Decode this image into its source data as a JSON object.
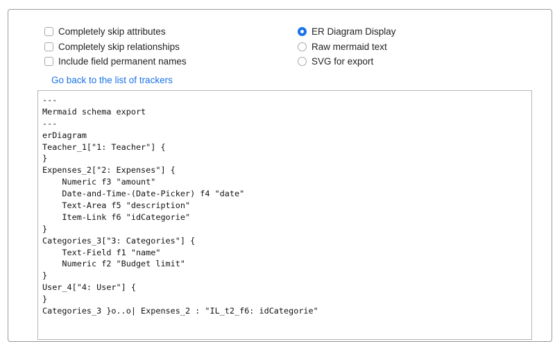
{
  "checkboxes": [
    {
      "label": "Completely skip attributes",
      "checked": false
    },
    {
      "label": "Completely skip relationships",
      "checked": false
    },
    {
      "label": "Include field permanent names",
      "checked": false
    }
  ],
  "display_modes": [
    {
      "label": "ER Diagram Display",
      "selected": true
    },
    {
      "label": "Raw mermaid text",
      "selected": false
    },
    {
      "label": "SVG for export",
      "selected": false
    }
  ],
  "back_link": "Go back to the list of trackers",
  "output_lines": [
    "---",
    "Mermaid schema export",
    "---",
    "erDiagram",
    "Teacher_1[\"1: Teacher\"] {",
    "}",
    "Expenses_2[\"2: Expenses\"] {",
    "    Numeric f3 \"amount\"",
    "    Date-and-Time-(Date-Picker) f4 \"date\"",
    "    Text-Area f5 \"description\"",
    "    Item-Link f6 \"idCategorie\"",
    "}",
    "Categories_3[\"3: Categories\"] {",
    "    Text-Field f1 \"name\"",
    "    Numeric f2 \"Budget limit\"",
    "}",
    "User_4[\"4: User\"] {",
    "}",
    "Categories_3 }o..o| Expenses_2 : \"IL_t2_f6: idCategorie\""
  ],
  "colors": {
    "accent": "#1a73e8",
    "border": "#9a9a9a"
  }
}
